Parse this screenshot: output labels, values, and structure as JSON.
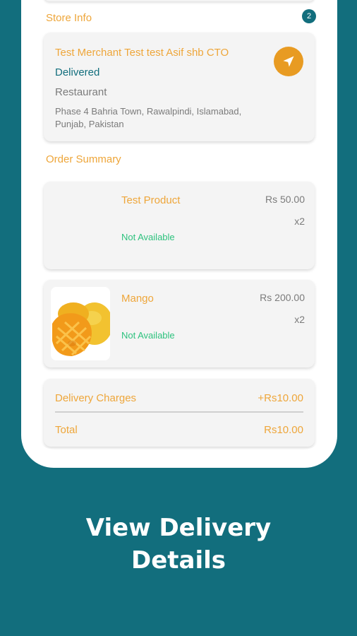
{
  "store_section": {
    "title": "Store Info",
    "badge_count": "2",
    "store_name": "Test Merchant Test test Asif shb CTO",
    "status": "Delivered",
    "type": "Restaurant",
    "address": "Phase 4 Bahria Town, Rawalpindi, Islamabad, Punjab, Pakistan",
    "navigate_icon": "navigation-arrow-icon"
  },
  "order_section": {
    "title": "Order Summary",
    "items": [
      {
        "name": "Test Product",
        "price": "Rs 50.00",
        "quantity": "x2",
        "availability": "Not Available"
      },
      {
        "name": "Mango",
        "price": "Rs 200.00",
        "quantity": "x2",
        "availability": "Not Available",
        "image": "mango-image"
      }
    ]
  },
  "summary": {
    "delivery_label": "Delivery Charges",
    "delivery_value": "+Rs10.00",
    "total_label": "Total",
    "total_value": "Rs10.00"
  },
  "headline": {
    "line1": "View Delivery",
    "line2": "Details"
  },
  "colors": {
    "background": "#126e7d",
    "accent_orange": "#eea63a",
    "status_teal": "#126e7d",
    "available_green": "#2ec27e"
  }
}
